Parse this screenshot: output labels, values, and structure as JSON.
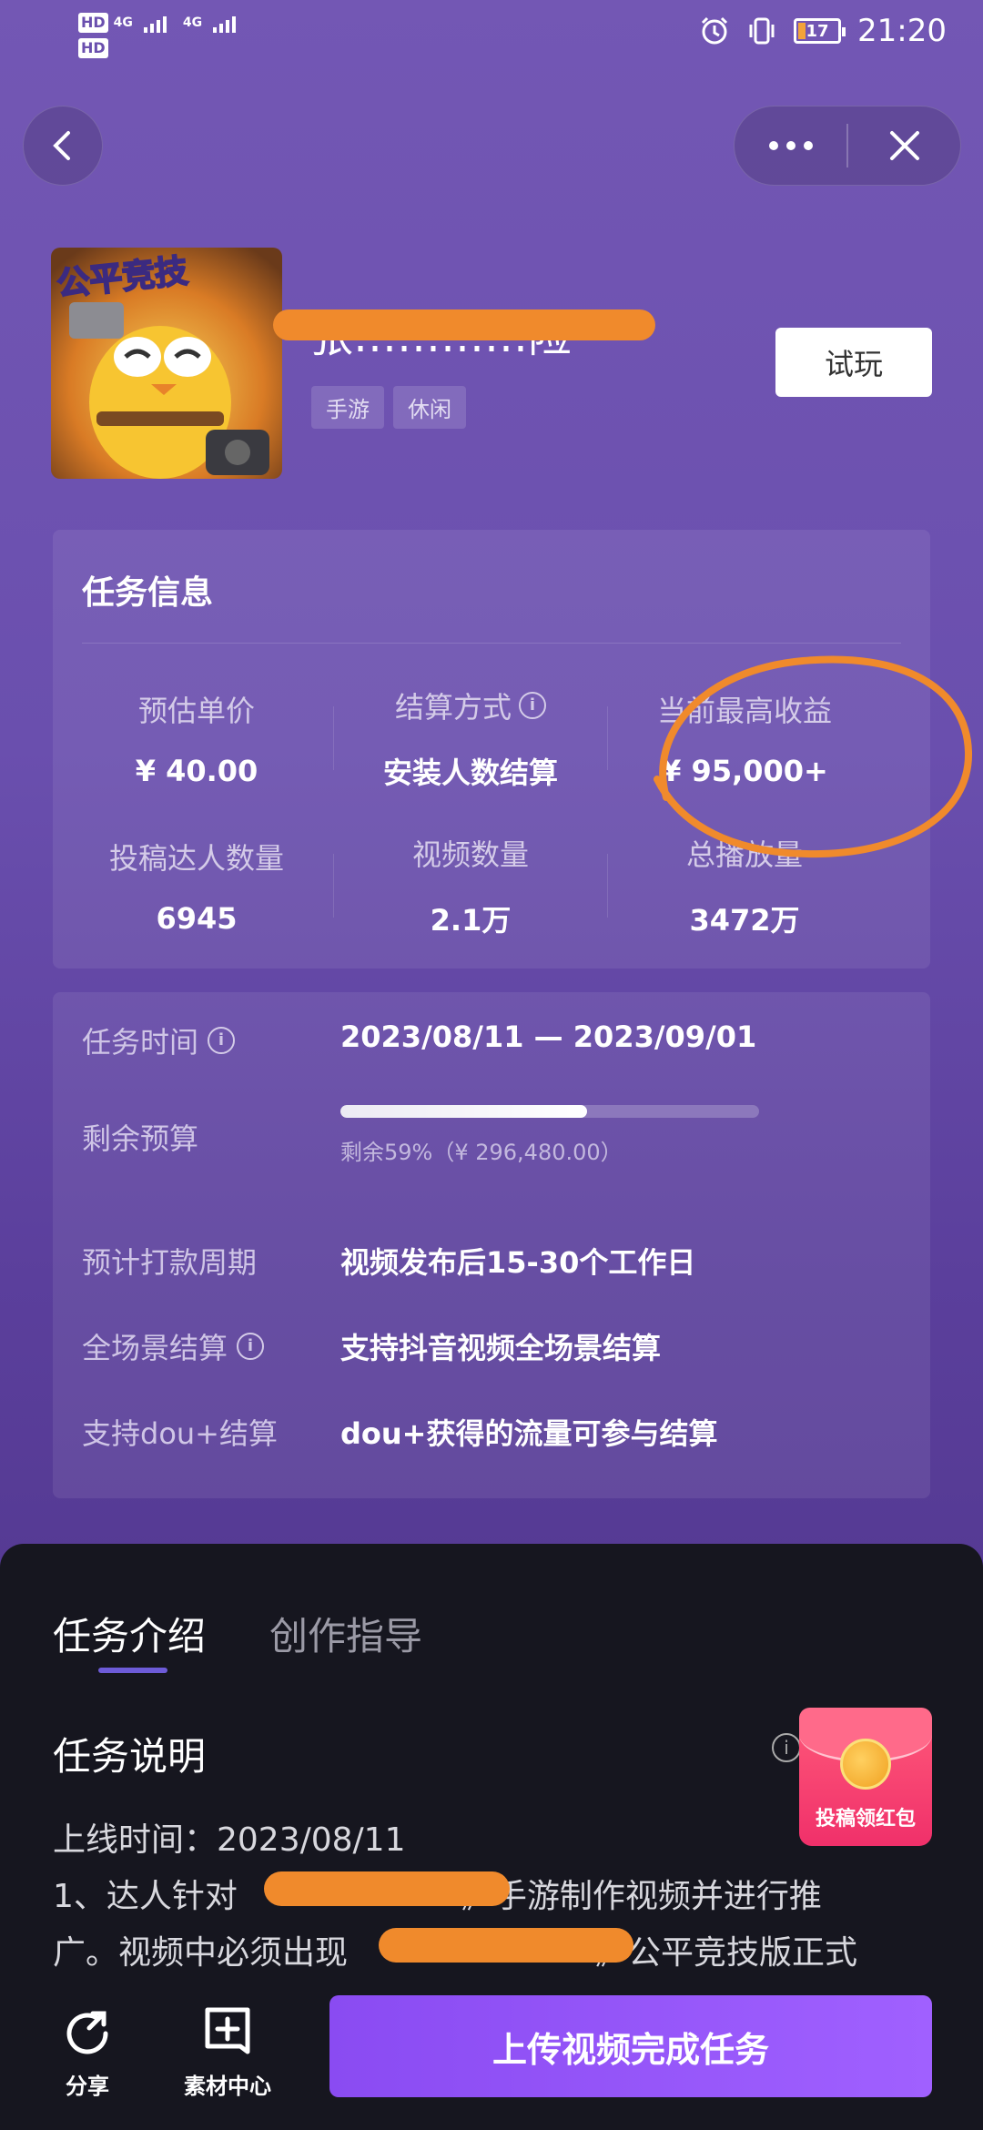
{
  "status_bar": {
    "hd1": "HD",
    "hd2": "HD",
    "net1": "4G",
    "net2": "4G",
    "battery": "17",
    "time": "21:20"
  },
  "nav": {
    "more_label": "···"
  },
  "game": {
    "title": "张…………险",
    "tags": [
      "手游",
      "休闲"
    ],
    "icon_caption": "公平竞技",
    "try_button": "试玩"
  },
  "task_info": {
    "title": "任务信息",
    "stats": [
      {
        "label": "预估单价",
        "value": "¥ 40.00"
      },
      {
        "label": "结算方式",
        "value": "安装人数结算"
      },
      {
        "label": "当前最高收益",
        "value": "¥ 95,000+"
      },
      {
        "label": "投稿达人数量",
        "value": "6945"
      },
      {
        "label": "视频数量",
        "value": "2.1万"
      },
      {
        "label": "总播放量",
        "value": "3472万"
      }
    ]
  },
  "task_details": {
    "time_label": "任务时间",
    "time_value": "2023/08/11 — 2023/09/01",
    "budget_label": "剩余预算",
    "budget_fraction": 0.59,
    "budget_text": "剩余59%（¥ 296,480.00）",
    "payment_label": "预计打款周期",
    "payment_value": "视频发布后15-30个工作日",
    "scene_label": "全场景结算",
    "scene_value": "支持抖音视频全场景结算",
    "dou_label": "支持dou+结算",
    "dou_value": "dou+获得的流量可参与结算"
  },
  "sheet": {
    "tabs": [
      "任务介绍",
      "创作指导"
    ],
    "section_title": "任务说明",
    "online_time": "上线时间：2023/08/11",
    "line1_a": "1、达人针对",
    "line1_b": "》手游制作视频并进行推",
    "line2_a": "广。视频中必须出现",
    "line2_b": "》公平竞技版正式",
    "redpack_text": "投稿领红包"
  },
  "bottom_bar": {
    "share": "分享",
    "material": "素材中心",
    "upload": "上传视频完成任务"
  },
  "colors": {
    "accent": "#8a4bf2",
    "annotation": "#f08a2c",
    "sheet_bg": "#16161f"
  }
}
